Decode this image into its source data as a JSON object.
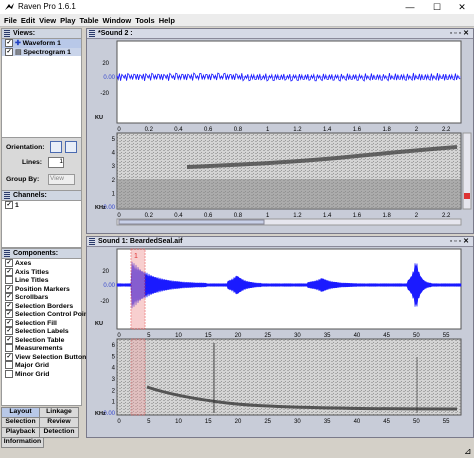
{
  "window": {
    "title": "Raven Pro 1.6.1",
    "minimize": "—",
    "maximize": "☐",
    "close": "✕"
  },
  "menu": [
    "File",
    "Edit",
    "View",
    "Play",
    "Table",
    "Window",
    "Tools",
    "Help"
  ],
  "views_panel": {
    "title": "Views:",
    "items": [
      {
        "label": "Waveform 1",
        "checked": true
      },
      {
        "label": "Spectrogram 1",
        "checked": true
      }
    ]
  },
  "orientation": {
    "label": "Orientation:",
    "lines_label": "Lines:",
    "lines_value": "1",
    "group_by_label": "Group By:",
    "group_by_value": "View"
  },
  "channels_panel": {
    "title": "Channels:",
    "items": [
      {
        "label": "1",
        "checked": true
      }
    ]
  },
  "components_panel": {
    "title": "Components:",
    "items": [
      {
        "label": "Axes",
        "checked": true
      },
      {
        "label": "Axis Titles",
        "checked": true
      },
      {
        "label": "Line Titles",
        "checked": false
      },
      {
        "label": "Position Markers",
        "checked": true
      },
      {
        "label": "Scrollbars",
        "checked": true
      },
      {
        "label": "Selection Borders",
        "checked": true
      },
      {
        "label": "Selection Control Point",
        "checked": true
      },
      {
        "label": "Selection Fill",
        "checked": true
      },
      {
        "label": "Selection Labels",
        "checked": true
      },
      {
        "label": "Selection Table",
        "checked": true
      },
      {
        "label": "Measurements",
        "checked": false
      },
      {
        "label": "View Selection Buttons",
        "checked": true
      },
      {
        "label": "Major Grid",
        "checked": false
      },
      {
        "label": "Minor Grid",
        "checked": false
      }
    ]
  },
  "side_tabs": [
    "Layout",
    "Linkage",
    "Selection",
    "Review",
    "Playback",
    "Detection",
    "Information"
  ],
  "sound2": {
    "title": "*Sound 2 :",
    "waveform": {
      "ylabel": "KU",
      "yticks": [
        "20",
        "0.00",
        "-20"
      ],
      "xlabel": "S"
    },
    "spectrogram": {
      "ylabel": "KHz",
      "yticks": [
        "5",
        "4",
        "3",
        "2",
        "1",
        "0.00"
      ],
      "xlabel": "S"
    },
    "xticks": [
      "0",
      "0.2",
      "0.4",
      "0.6",
      "0.8",
      "1",
      "1.2",
      "1.4",
      "1.6",
      "1.8",
      "2",
      "2.2"
    ]
  },
  "sound1": {
    "title": "Sound 1: BeardedSeal.aif",
    "waveform": {
      "ylabel": "KU",
      "yticks": [
        "20",
        "0.00",
        "-20"
      ],
      "xlabel": "S"
    },
    "spectrogram": {
      "ylabel": "KHz",
      "yticks": [
        "6",
        "5",
        "4",
        "3",
        "2",
        "1",
        "0.00"
      ],
      "xlabel": "S"
    },
    "xticks": [
      "0",
      "5",
      "10",
      "15",
      "20",
      "25",
      "30",
      "35",
      "40",
      "45",
      "50",
      "55"
    ],
    "selection_label": "1"
  },
  "colors": {
    "waveform": "#1a1aff",
    "selection": "#e03030",
    "axis_zero": "#5a5aff"
  }
}
